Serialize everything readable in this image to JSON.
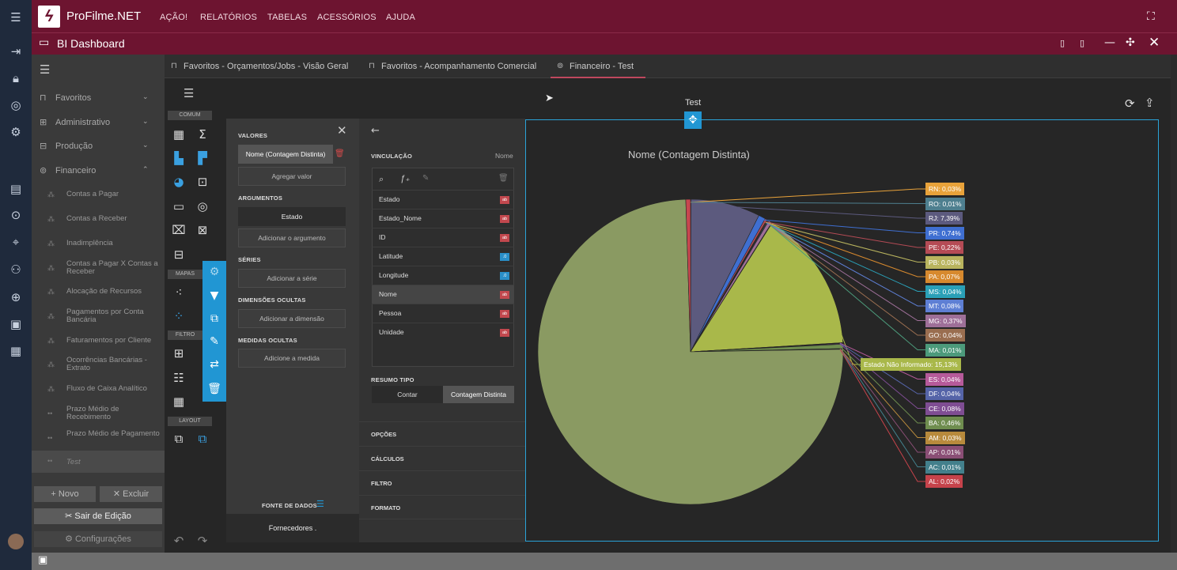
{
  "app": {
    "name": "ProFilme.NET",
    "logo": "ϟ",
    "menu": [
      "AÇÃO!",
      "RELATÓRIOS",
      "TABELAS",
      "ACESSÓRIOS",
      "AJUDA"
    ]
  },
  "page": {
    "title": "BI Dashboard"
  },
  "colors": {
    "brand": "#6d1430",
    "accent": "#2196d3",
    "rail": "#1f2a3c"
  },
  "nav": {
    "groups": [
      {
        "label": "Favoritos",
        "icon": "bookmark-icon"
      },
      {
        "label": "Administrativo",
        "icon": "sitemap-icon"
      },
      {
        "label": "Produção",
        "icon": "camera-icon"
      },
      {
        "label": "Financeiro",
        "icon": "money-icon"
      }
    ],
    "items": [
      "Contas a Pagar",
      "Contas a Receber",
      "Inadimplência",
      "Contas a Pagar X Contas a Receber",
      "Alocação de Recursos",
      "Pagamentos por Conta Bancária",
      "Faturamentos por Cliente",
      "Ocorrências Bancárias - Extrato",
      "Fluxo de Caixa Analítico",
      "Prazo Médio de Recebimento",
      "Prazo Médio de Pagamento",
      "Test"
    ],
    "new_label": "Novo",
    "delete_label": "Excluir",
    "exit_edit_label": "Sair de Edição",
    "settings_label": "Configurações"
  },
  "tabs": [
    "Favoritos - Orçamentos/Jobs - Visão Geral",
    "Favoritos - Acompanhamento Comercial",
    "Financeiro - Test"
  ],
  "toolbox": {
    "sections": [
      "COMUM",
      "MAPAS",
      "FILTRO",
      "LAYOUT"
    ]
  },
  "config": {
    "valores": "VALORES",
    "valor_item": "Nome (Contagem Distinta)",
    "add_value": "Agregar valor",
    "argumentos": "ARGUMENTOS",
    "arg_item": "Estado",
    "add_arg": "Adicionar o argumento",
    "series": "SÉRIES",
    "add_series": "Adicionar a série",
    "dim_ocultas": "DIMENSÕES OCULTAS",
    "add_dim": "Adicionar a dimensão",
    "med_ocultas": "MEDIDAS OCULTAS",
    "add_med": "Adicione a medida",
    "fonte_label": "FONTE DE DADOS",
    "fonte_value": "Fornecedores ."
  },
  "binding": {
    "title": "VINCULAÇÃO",
    "current": "Nome",
    "fields": [
      {
        "name": "Estado",
        "type": "ab"
      },
      {
        "name": "Estado_Nome",
        "type": "ab"
      },
      {
        "name": "ID",
        "type": "ab"
      },
      {
        "name": "Latitude",
        "type": ".0"
      },
      {
        "name": "Longitude",
        "type": ".0"
      },
      {
        "name": "Nome",
        "type": "ab"
      },
      {
        "name": "Pessoa",
        "type": "ab"
      },
      {
        "name": "Unidade",
        "type": "ab"
      }
    ],
    "resumo_label": "RESUMO TIPO",
    "resumo_options": [
      "Contar",
      "Contagem Distinta"
    ],
    "sections": [
      "OPÇÕES",
      "CÁLCULOS",
      "FILTRO",
      "FORMATO"
    ]
  },
  "dashboard_item": {
    "title": "Test"
  },
  "chart_data": {
    "type": "pie",
    "title": "Nome (Contagem Distinta)",
    "slices": [
      {
        "label": "RN: 0,03%",
        "value": 0.03,
        "color": "#e8a23a"
      },
      {
        "label": "RO: 0,01%",
        "value": 0.01,
        "color": "#4e7f8f"
      },
      {
        "label": "RJ: 7,39%",
        "value": 7.39,
        "color": "#5c5a7e"
      },
      {
        "label": "PR: 0,74%",
        "value": 0.74,
        "color": "#3f6fd1"
      },
      {
        "label": "PE: 0,22%",
        "value": 0.22,
        "color": "#b54b55"
      },
      {
        "label": "PB: 0,03%",
        "value": 0.03,
        "color": "#b9b45e"
      },
      {
        "label": "PA: 0,07%",
        "value": 0.07,
        "color": "#d7892e"
      },
      {
        "label": "MS: 0,04%",
        "value": 0.04,
        "color": "#2aa0b7"
      },
      {
        "label": "MT: 0,08%",
        "value": 0.08,
        "color": "#5e7fd4"
      },
      {
        "label": "MG: 0,37%",
        "value": 0.37,
        "color": "#9e6f98"
      },
      {
        "label": "GO: 0,04%",
        "value": 0.04,
        "color": "#9a6e50"
      },
      {
        "label": "MA: 0,01%",
        "value": 0.01,
        "color": "#4c9a7b"
      },
      {
        "label": "Estado Não Informado: 15,13%",
        "value": 15.13,
        "color": "#a9b84a"
      },
      {
        "label": "ES: 0,04%",
        "value": 0.04,
        "color": "#b65a9a"
      },
      {
        "label": "DF: 0,04%",
        "value": 0.04,
        "color": "#5564a8"
      },
      {
        "label": "CE: 0,08%",
        "value": 0.08,
        "color": "#7f4d93"
      },
      {
        "label": "BA: 0,46%",
        "value": 0.46,
        "color": "#6f8d4f"
      },
      {
        "label": "AM: 0,03%",
        "value": 0.03,
        "color": "#b88a3c"
      },
      {
        "label": "AP: 0,01%",
        "value": 0.01,
        "color": "#8a4e75"
      },
      {
        "label": "AC: 0,01%",
        "value": 0.01,
        "color": "#43808c"
      },
      {
        "label": "AL: 0,02%",
        "value": 0.02,
        "color": "#c6434b"
      },
      {
        "label": "",
        "value": 75.12,
        "color": "#8a9a62"
      },
      {
        "label": "",
        "value": 0.5,
        "color": "#c8464f"
      }
    ]
  }
}
